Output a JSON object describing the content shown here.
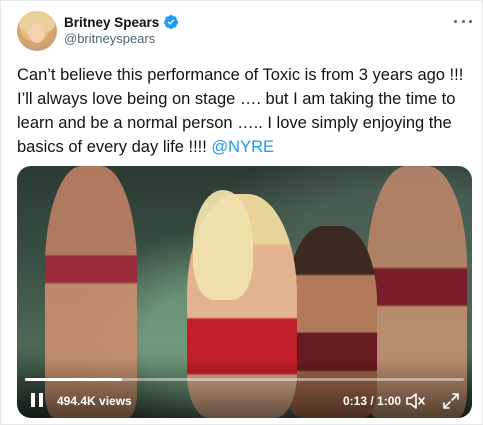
{
  "author": {
    "display_name": "Britney Spears",
    "handle": "@britneyspears",
    "verified": true
  },
  "tweet": {
    "text": "Can’t believe this performance of Toxic is from 3 years ago !!! I’ll always love being on stage …. but I am taking the time to learn and be a normal person ….. I love simply enjoying the basics of every day life !!!! ",
    "mention": "@NYRE"
  },
  "video": {
    "views": "494.4K views",
    "time": "0:13 / 1:00",
    "progress": 0.22,
    "state": "playing"
  },
  "colors": {
    "accent": "#1d9bf0",
    "text": "#0f1419",
    "muted": "#536471"
  },
  "icons": {
    "verified": "verified-badge-icon",
    "more": "more-options-icon",
    "pause": "pause-icon",
    "mute": "mute-icon",
    "fullscreen": "fullscreen-icon"
  }
}
